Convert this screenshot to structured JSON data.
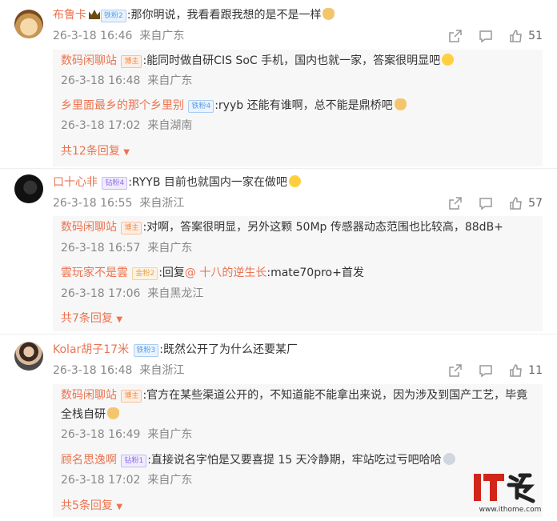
{
  "comments": [
    {
      "user": "布鲁卡",
      "badge": "铁粉2",
      "text": ":那你明说，我看看跟我想的是不是一样",
      "time": "26-3-18 16:46",
      "location": "来自广东",
      "likes": "51",
      "replies": [
        {
          "user": "数码闲聊站",
          "badge": "博主",
          "text": ":能同时做自研CIS SoC 手机，国内也就一家，答案很明显吧",
          "time": "26-3-18 16:48",
          "location": "来自广东"
        },
        {
          "user": "乡里面最乡的那个乡里别",
          "badge": "铁粉4",
          "text": ":ryyb 还能有谁啊，总不能是鼎桥吧",
          "time": "26-3-18 17:02",
          "location": "来自湖南"
        }
      ],
      "more": "共12条回复"
    },
    {
      "user": "口十心非",
      "badge": "钻粉4",
      "text": ":RYYB 目前也就国内一家在做吧",
      "time": "26-3-18 16:55",
      "location": "来自浙江",
      "likes": "57",
      "replies": [
        {
          "user": "数码闲聊站",
          "badge": "博主",
          "text": ":对啊，答案很明显，另外这颗 50Mp 传感器动态范围也比较高，88dB+",
          "time": "26-3-18 16:57",
          "location": "来自广东"
        },
        {
          "user": "雲玩家不是雲",
          "badge": "金粉2",
          "text": ":回复",
          "at": "@ 十八的逆生长",
          "text2": ":mate70pro+首发",
          "time": "26-3-18 17:06",
          "location": "来自黑龙江"
        }
      ],
      "more": "共7条回复"
    },
    {
      "user": "Kolar胡子17米",
      "badge": "铁粉3",
      "text": ":既然公开了为什么还要某厂",
      "time": "26-3-18 16:48",
      "location": "来自浙江",
      "likes": "11",
      "replies": [
        {
          "user": "数码闲聊站",
          "badge": "博主",
          "text": ":官方在某些渠道公开的，不知道能不能拿出来说，因为涉及到国产工艺，毕竟",
          "text2": "全栈自研",
          "time": "26-3-18 16:49",
          "location": "来自广东"
        },
        {
          "user": "顾名思逸啊",
          "badge": "钻粉1",
          "text": ":直接说名字怕是又要喜提 15 天冷静期，牢站吃过亏吧哈哈",
          "time": "26-3-18 17:02",
          "location": "来自广东"
        }
      ],
      "more": "共5条回复"
    }
  ],
  "watermark": {
    "logo_text": "IT之家",
    "url": "www.ithome.com"
  },
  "colors": {
    "accent": "#eb7350",
    "meta": "#888888",
    "reply_bg": "#f7f7f7"
  }
}
